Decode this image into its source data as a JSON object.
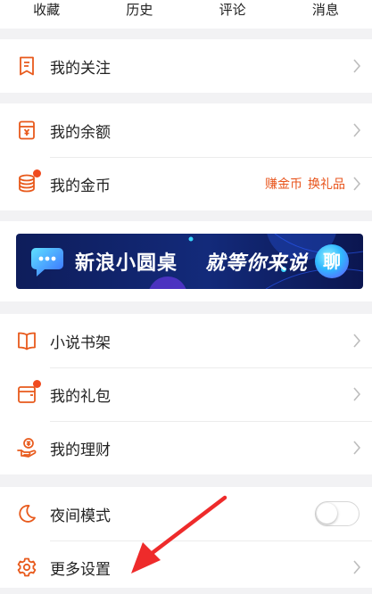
{
  "top_tabs": [
    "收藏",
    "历史",
    "评论",
    "消息"
  ],
  "menu": {
    "follow": "我的关注",
    "balance": "我的余额",
    "coins": "我的金币",
    "coins_extra": [
      "赚金币",
      "换礼品"
    ],
    "novel_shelf": "小说书架",
    "gift_pack": "我的礼包",
    "finance": "我的理财",
    "night_mode": "夜间模式",
    "more_settings": "更多设置"
  },
  "banner": {
    "text1": "新浪小圆桌",
    "text2": "就等你来说",
    "badge": "聊"
  },
  "night_mode_on": false,
  "colors": {
    "accent": "#e8541c",
    "icon": "#e85a1c",
    "badge_dot": "#f04b1f",
    "annotation_arrow": "#ee2b2b",
    "banner_bg": "#132a7a"
  }
}
